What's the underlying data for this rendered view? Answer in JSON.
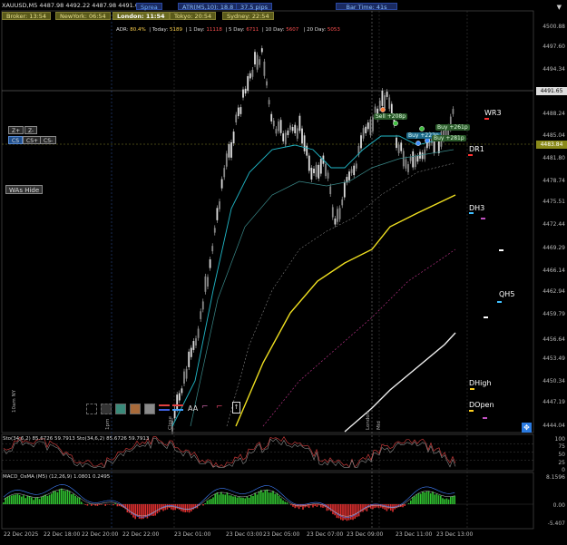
{
  "symbol": {
    "text": "XAUUSD,M5  4487.98 4492.22 4487.98 4491.65"
  },
  "topbar": {
    "spread_label": "Sprea",
    "atr_label": "ATR(M5,10): 18.8",
    "pips_label": "37.5 pips",
    "bartime_label": "Bar Time: 41s"
  },
  "sessions": [
    {
      "label": "Broker: 13:54",
      "active": false
    },
    {
      "label": "NewYork: 06:54",
      "active": false
    },
    {
      "label": "London: 11:54",
      "active": true
    },
    {
      "label": "Tokyo: 20:54",
      "active": false
    },
    {
      "label": "Sydney: 22:54",
      "active": false
    }
  ],
  "adr": {
    "adr_label": "ADR:",
    "adr_value": "80.4%",
    "today_label": "| Today:",
    "today_value": "5189",
    "day1_label": "| 1 Day:",
    "day1_value": "11118",
    "day5_label": "| 5 Day:",
    "day5_value": "6711",
    "day10_label": "| 10 Day:",
    "day10_value": "5607",
    "day20_label": "| 20 Day:",
    "day20_value": "5053"
  },
  "zoom_buttons": {
    "zplus": "Z+",
    "zminus": "Z-",
    "cs": "CS",
    "csplus": "CS+",
    "csminus": "CS-"
  },
  "was_hide": "WAs Hide",
  "price_axis": [
    "4500.88",
    "4497.60",
    "4494.34",
    "4491.65",
    "4488.24",
    "4485.04",
    "4483.84",
    "4481.80",
    "4478.74",
    "4475.51",
    "4472.44",
    "4469.29",
    "4466.14",
    "4462.94",
    "4459.79",
    "4456.64",
    "4453.49",
    "4450.34",
    "4447.19",
    "4444.04"
  ],
  "current_price": "4491.65",
  "bid_price": "4483.84",
  "levels": {
    "wr3": "WR3",
    "dr1": "DR1",
    "dh3": "DH3",
    "qh5": "QH5",
    "dhigh": "DHigh",
    "dopen": "DOpen"
  },
  "trades": {
    "sell": "Sell +208p",
    "buy1": "Buy +261p",
    "buy2": "Buy +222p",
    "buy3": "Buy +281p"
  },
  "session_markers": {
    "tenam_ny": "10am NY",
    "ipm": "1pm",
    "close": "Close",
    "london": "London",
    "mid": "Mid"
  },
  "stoch_panel": {
    "label": "Sto(34,6,2) 85.6726 59.7913  Sto(34,6,2) 85.6726 59.7913",
    "axis": [
      "100",
      "75",
      "50",
      "25",
      "0"
    ]
  },
  "macd_panel": {
    "label": "MACD_OsMA (M5) (12,26,9) 1.0801 0.2495",
    "axis": [
      "8.1596",
      "0.00",
      "-5.407"
    ]
  },
  "time_axis": [
    "22 Dec 2025",
    "22 Dec 18:00",
    "22 Dec 20:00",
    "22 Dec 22:00",
    "23 Dec 01:00",
    "23 Dec 03:00",
    "23 Dec 05:00",
    "23 Dec 07:00",
    "23 Dec 09:00",
    "23 Dec 11:00",
    "23 Dec 13:00"
  ],
  "toolbar_icons": {
    "aa": "AA"
  }
}
